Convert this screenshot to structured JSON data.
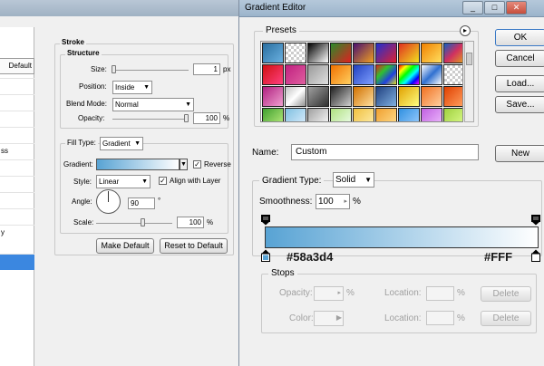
{
  "layer_style": {
    "default_label": "Default",
    "sidebar_fragments": [
      "ss",
      "y"
    ],
    "stroke_title": "Stroke",
    "structure_title": "Structure",
    "size_label": "Size:",
    "size_value": "1",
    "size_unit": "px",
    "position_label": "Position:",
    "position_value": "Inside",
    "blend_mode_label": "Blend Mode:",
    "blend_mode_value": "Normal",
    "opacity_label": "Opacity:",
    "opacity_value": "100",
    "opacity_unit": "%",
    "fill_type_label": "Fill Type:",
    "fill_type_value": "Gradient",
    "gradient_label": "Gradient:",
    "reverse_label": "Reverse",
    "reverse_checked": true,
    "style_label": "Style:",
    "style_value": "Linear",
    "align_label": "Align with Layer",
    "align_checked": true,
    "angle_label": "Angle:",
    "angle_value": "90",
    "angle_unit": "°",
    "scale_label": "Scale:",
    "scale_value": "100",
    "scale_unit": "%",
    "make_default": "Make Default",
    "reset_default": "Reset to Default"
  },
  "gradient_editor": {
    "title": "Gradient Editor",
    "minimize_icon": "_",
    "maximize_icon": "□",
    "close_icon": "✕",
    "presets_label": "Presets",
    "menu_icon": "▸",
    "ok_button": "OK",
    "cancel_button": "Cancel",
    "load_button": "Load...",
    "save_button": "Save...",
    "name_label": "Name:",
    "name_value": "Custom",
    "new_button": "New",
    "gradient_type_label": "Gradient Type:",
    "gradient_type_value": "Solid",
    "smoothness_label": "Smoothness:",
    "smoothness_value": "100",
    "smoothness_unit": "%",
    "color_stop_left": "#58a3d4",
    "color_stop_right": "#FFF",
    "stops_label": "Stops",
    "opacity_label": "Opacity:",
    "opacity_unit": "%",
    "location_label": "Location:",
    "location_unit": "%",
    "delete_label": "Delete",
    "color_label": "Color:",
    "colors": {
      "gradient_start": "#58a3d4",
      "gradient_end": "#ffffff"
    }
  }
}
